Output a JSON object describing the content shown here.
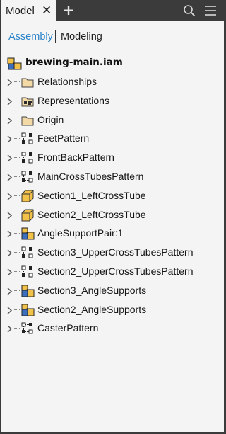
{
  "tabs": {
    "model_label": "Model",
    "add_label": "+"
  },
  "modes": {
    "assembly": "Assembly",
    "modeling": "Modeling"
  },
  "tree": {
    "root": "brewing-main.iam",
    "items": [
      {
        "label": "Relationships",
        "icon": "folder-icon"
      },
      {
        "label": "Representations",
        "icon": "representations-icon"
      },
      {
        "label": "Origin",
        "icon": "folder-icon"
      },
      {
        "label": "FeetPattern",
        "icon": "pattern-icon"
      },
      {
        "label": "FrontBackPattern",
        "icon": "pattern-icon"
      },
      {
        "label": "MainCrossTubesPattern",
        "icon": "pattern-icon"
      },
      {
        "label": "Section1_LeftCrossTube",
        "icon": "part-icon"
      },
      {
        "label": "Section2_LeftCrossTube",
        "icon": "part-icon"
      },
      {
        "label": "AngleSupportPair:1",
        "icon": "assembly-icon"
      },
      {
        "label": "Section3_UpperCrossTubesPattern",
        "icon": "pattern-icon"
      },
      {
        "label": "Section2_UpperCrossTubesPattern",
        "icon": "pattern-icon"
      },
      {
        "label": "Section3_AngleSupports",
        "icon": "assembly-icon"
      },
      {
        "label": "Section2_AngleSupports",
        "icon": "assembly-icon"
      },
      {
        "label": "CasterPattern",
        "icon": "pattern-icon"
      }
    ]
  }
}
